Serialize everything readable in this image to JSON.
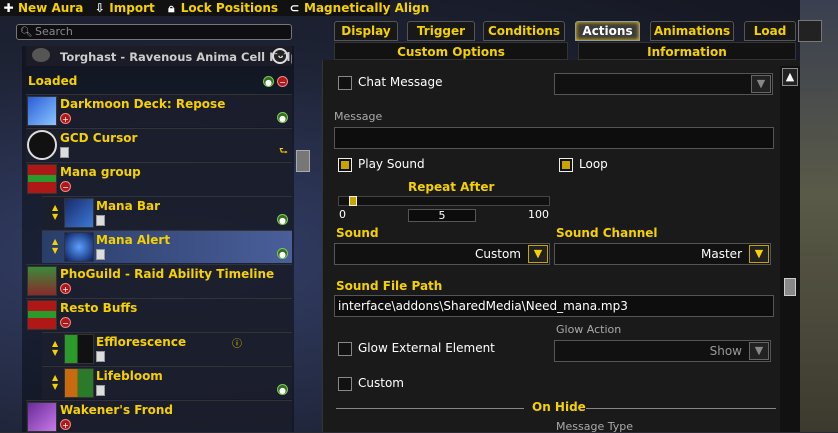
{
  "toolbar": {
    "new_aura": "New Aura",
    "import": "Import",
    "lock_positions": "Lock Positions",
    "magnetically_align": "Magnetically Align"
  },
  "search": {
    "placeholder": "Search"
  },
  "aura_list": {
    "truncated_item": "Torghast - Ravenous Anima Cell Helper",
    "section_label": "Loaded",
    "items": [
      {
        "name": "Darkmoon Deck: Repose"
      },
      {
        "name": "GCD Cursor"
      },
      {
        "name": "Mana group"
      },
      {
        "name": "Mana Bar"
      },
      {
        "name": "Mana Alert"
      },
      {
        "name": "PhoGuild - Raid Ability Timeline"
      },
      {
        "name": "Resto Buffs"
      },
      {
        "name": "Efflorescence"
      },
      {
        "name": "Lifebloom"
      },
      {
        "name": "Wakener's Frond"
      }
    ]
  },
  "tabs": {
    "row1": [
      "Display",
      "Trigger",
      "Conditions",
      "Actions",
      "Animations",
      "Load"
    ],
    "row2": [
      "Custom Options",
      "Information"
    ],
    "active": "Actions"
  },
  "actions": {
    "chat_message": "Chat Message",
    "message_label": "Message",
    "play_sound": "Play Sound",
    "loop": "Loop",
    "repeat_after": "Repeat After",
    "repeat_min": "0",
    "repeat_value": "5",
    "repeat_max": "100",
    "sound_label": "Sound",
    "sound_value": "Custom",
    "sound_channel_label": "Sound Channel",
    "sound_channel_value": "Master",
    "sound_file_path_label": "Sound File Path",
    "sound_file_path_value": "interface\\addons\\SharedMedia\\Need_mana.mp3",
    "glow_action_label": "Glow Action",
    "glow_external": "Glow External Element",
    "glow_action_value": "Show",
    "custom": "Custom",
    "on_hide": "On Hide",
    "message_type_label": "Message Type"
  },
  "colors": {
    "accent": "#f5d100",
    "active_tab": "#3c3c3c",
    "selected_row": "#4a5e9a"
  },
  "state": {
    "play_sound_checked": true,
    "loop_checked": true,
    "repeat_fraction": 0.05
  }
}
